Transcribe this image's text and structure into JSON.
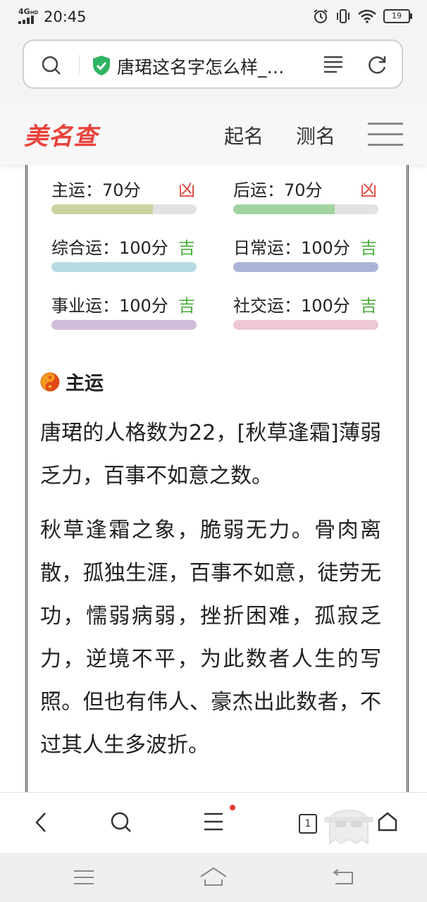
{
  "status_bar": {
    "network": "4G",
    "network_sub": "HD",
    "time": "20:45",
    "battery": "19"
  },
  "browser": {
    "url_title": "唐珺这名字怎么样_…",
    "icons": [
      "search-icon",
      "shield-check-icon",
      "reader-mode-icon",
      "reload-icon"
    ]
  },
  "site": {
    "logo": "美名查",
    "nav": [
      "起名",
      "测名"
    ]
  },
  "fortunes": [
    {
      "label": "主运：70分",
      "result": "凶",
      "score": 0.7,
      "color": "#c9d4a2",
      "result_color": "#e5453d"
    },
    {
      "label": "后运：70分",
      "result": "凶",
      "score": 0.7,
      "color": "#a3d4a0",
      "result_color": "#e5453d"
    },
    {
      "label": "综合运：100分",
      "result": "吉",
      "score": 1.0,
      "color": "#b4dce2",
      "result_color": "#4caf3c"
    },
    {
      "label": "日常运：100分",
      "result": "吉",
      "score": 1.0,
      "color": "#aab4d8",
      "result_color": "#4caf3c"
    },
    {
      "label": "事业运：100分",
      "result": "吉",
      "score": 1.0,
      "color": "#d2bcdc",
      "result_color": "#4caf3c"
    },
    {
      "label": "社交运：100分",
      "result": "吉",
      "score": 1.0,
      "color": "#eec9d4",
      "result_color": "#4caf3c"
    }
  ],
  "section": {
    "title": "主运",
    "paragraph1": "唐珺的人格数为22，[秋草逢霜]薄弱乏力，百事不如意之数。",
    "paragraph2": "秋草逢霜之象，脆弱无力。骨肉离散，孤独生涯，百事不如意，徒劳无功，懦弱病弱，挫折困难，孤寂乏力，逆境不平，为此数者人生的写照。但也有伟人、豪杰出此数者，不过其人生多波折。"
  },
  "toolbar": {
    "tab_count": "1",
    "icons": [
      "back-icon",
      "search-icon",
      "menu-icon",
      "tabs-icon",
      "ghost-icon",
      "home-icon"
    ]
  },
  "system_nav": {
    "icons": [
      "recent-apps-icon",
      "home-icon",
      "back-icon"
    ]
  }
}
